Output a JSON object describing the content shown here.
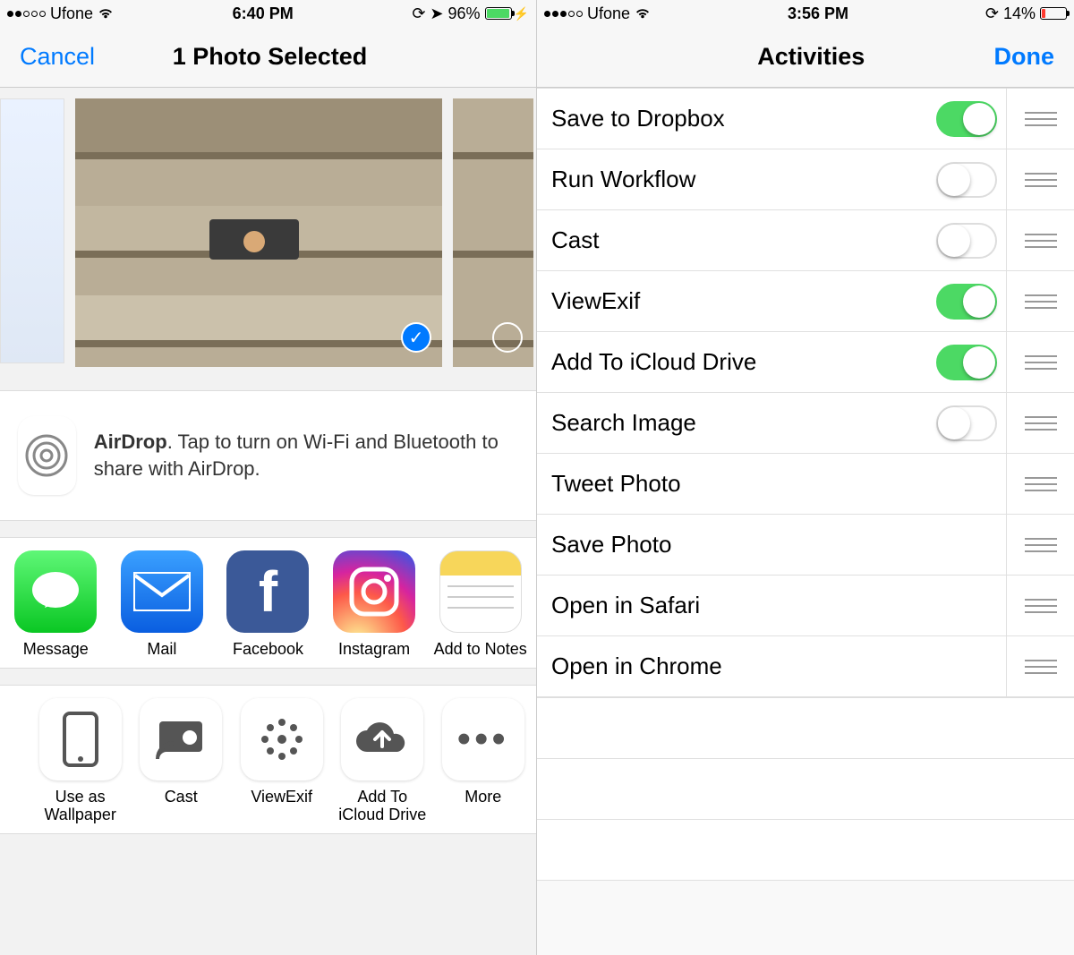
{
  "left": {
    "status": {
      "carrier": "Ufone",
      "time": "6:40 PM",
      "batteryPct": "96%",
      "signalFilled": 2
    },
    "nav": {
      "cancel": "Cancel",
      "title": "1 Photo Selected"
    },
    "airdrop": {
      "bold": "AirDrop",
      "text": ". Tap to turn on Wi-Fi and Bluetooth to share with AirDrop."
    },
    "shareApps": [
      {
        "label": "Message",
        "icon": "message"
      },
      {
        "label": "Mail",
        "icon": "mail"
      },
      {
        "label": "Facebook",
        "icon": "facebook"
      },
      {
        "label": "Instagram",
        "icon": "instagram"
      },
      {
        "label": "Add to Notes",
        "icon": "notes"
      }
    ],
    "actions": [
      {
        "label": "Use as Wallpaper",
        "icon": "wallpaper"
      },
      {
        "label": "Cast",
        "icon": "cast"
      },
      {
        "label": "ViewExif",
        "icon": "viewexif"
      },
      {
        "label": "Add To iCloud Drive",
        "icon": "icloud"
      },
      {
        "label": "More",
        "icon": "more"
      }
    ]
  },
  "right": {
    "status": {
      "carrier": "Ufone",
      "time": "3:56 PM",
      "batteryPct": "14%",
      "signalFilled": 3
    },
    "nav": {
      "title": "Activities",
      "done": "Done"
    },
    "activities": [
      {
        "name": "Save to Dropbox",
        "toggle": true,
        "on": true
      },
      {
        "name": "Run Workflow",
        "toggle": true,
        "on": false
      },
      {
        "name": "Cast",
        "toggle": true,
        "on": false
      },
      {
        "name": "ViewExif",
        "toggle": true,
        "on": true
      },
      {
        "name": "Add To iCloud Drive",
        "toggle": true,
        "on": true
      },
      {
        "name": "Search Image",
        "toggle": true,
        "on": false
      },
      {
        "name": "Tweet Photo",
        "toggle": false
      },
      {
        "name": "Save Photo",
        "toggle": false
      },
      {
        "name": "Open in Safari",
        "toggle": false
      },
      {
        "name": "Open in Chrome",
        "toggle": false
      }
    ]
  }
}
